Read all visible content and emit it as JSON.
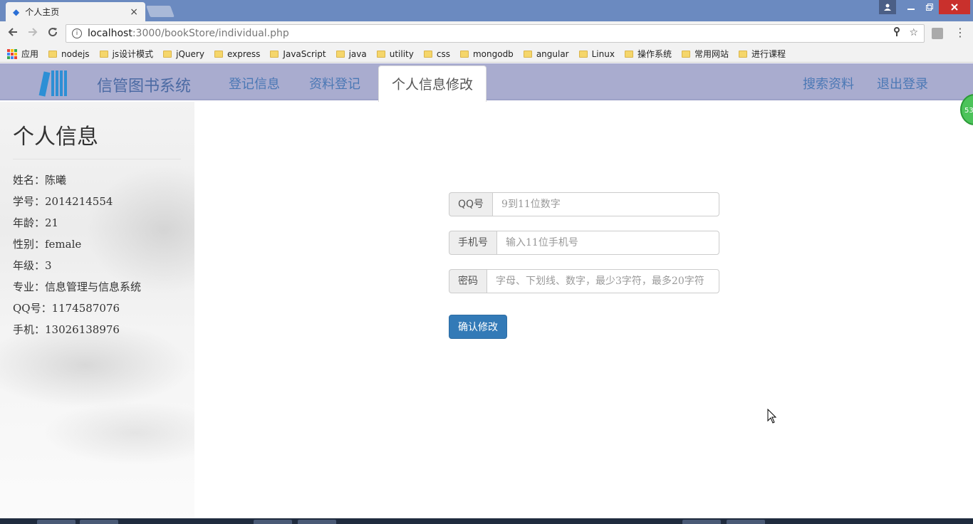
{
  "browser": {
    "tab_title": "个人主页",
    "tab_close": "×",
    "url_host": "localhost",
    "url_path": ":3000/bookStore/individual.php",
    "bookmarks": [
      {
        "label": "应用",
        "type": "apps"
      },
      {
        "label": "nodejs",
        "type": "folder"
      },
      {
        "label": "js设计模式",
        "type": "folder"
      },
      {
        "label": "jQuery",
        "type": "folder"
      },
      {
        "label": "express",
        "type": "folder"
      },
      {
        "label": "JavaScript",
        "type": "folder"
      },
      {
        "label": "java",
        "type": "folder"
      },
      {
        "label": "utility",
        "type": "folder"
      },
      {
        "label": "css",
        "type": "folder"
      },
      {
        "label": "mongodb",
        "type": "folder"
      },
      {
        "label": "angular",
        "type": "folder"
      },
      {
        "label": "Linux",
        "type": "folder"
      },
      {
        "label": "操作系统",
        "type": "folder"
      },
      {
        "label": "常用网站",
        "type": "folder"
      },
      {
        "label": "进行课程",
        "type": "folder"
      }
    ]
  },
  "navbar": {
    "brand": "信管图书系统",
    "links": {
      "register_info": "登记信息",
      "data_register": "资料登记",
      "edit_profile": "个人信息修改",
      "search": "搜索资料",
      "logout": "退出登录"
    },
    "badge": "53"
  },
  "sidebar": {
    "title": "个人信息",
    "items": [
      "姓名：陈曦",
      "学号：2014214554",
      "年龄：21",
      "性别：female",
      "年级：3",
      "专业：信息管理与信息系统",
      "QQ号：1174587076",
      "手机：13026138976"
    ]
  },
  "form": {
    "qq": {
      "label": "QQ号",
      "placeholder": "9到11位数字",
      "value": ""
    },
    "phone": {
      "label": "手机号",
      "placeholder": "输入11位手机号",
      "value": ""
    },
    "password": {
      "label": "密码",
      "placeholder": "字母、下划线、数字，最少3字符，最多20字符",
      "value": ""
    },
    "submit": "确认修改"
  },
  "colors": {
    "navbar_bg": "#a9accf",
    "nav_link": "#4b78b5",
    "primary_button": "#337ab7",
    "browser_frame": "#6b8ac0"
  }
}
